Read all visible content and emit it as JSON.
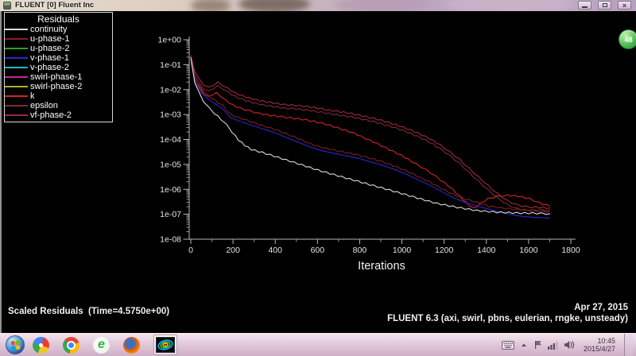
{
  "window": {
    "title": "FLUENT [0] Fluent Inc"
  },
  "legend": {
    "title": "Residuals",
    "items": [
      {
        "label": "continuity",
        "color": "#d9d9d9"
      },
      {
        "label": "u-phase-1",
        "color": "#8b2020"
      },
      {
        "label": "u-phase-2",
        "color": "#28a428"
      },
      {
        "label": "v-phase-1",
        "color": "#2828cc"
      },
      {
        "label": "v-phase-2",
        "color": "#20b8b8"
      },
      {
        "label": "swirl-phase-1",
        "color": "#c02898"
      },
      {
        "label": "swirl-phase-2",
        "color": "#b0b028"
      },
      {
        "label": "k",
        "color": "#d42424"
      },
      {
        "label": "epsilon",
        "color": "#7e2a38"
      },
      {
        "label": "vf-phase-2",
        "color": "#9e2a3e"
      }
    ]
  },
  "chart_data": {
    "type": "line",
    "title": "Scaled Residuals",
    "xlabel": "Iterations",
    "y_scale": "log",
    "ylim": [
      1e-08,
      1
    ],
    "xlim": [
      0,
      1820
    ],
    "grid": false,
    "legend_position": "top-left-box",
    "x_ticks": [
      0,
      200,
      400,
      600,
      800,
      1000,
      1200,
      1400,
      1600,
      1800
    ],
    "y_tick_labels": [
      "1e+00",
      "1e-01",
      "1e-02",
      "1e-03",
      "1e-04",
      "1e-05",
      "1e-06",
      "1e-07",
      "1e-08"
    ],
    "series": [
      {
        "name": "vf-phase-2",
        "color": "#9e2a3e",
        "jagged": true,
        "points": [
          [
            0,
            0.22
          ],
          [
            19,
            0.055
          ],
          [
            38,
            0.027
          ],
          [
            60,
            0.016
          ],
          [
            83,
            0.012
          ],
          [
            105,
            0.015
          ],
          [
            128,
            0.019
          ],
          [
            151,
            0.015
          ],
          [
            177,
            0.011
          ],
          [
            207,
            0.0075
          ],
          [
            245,
            0.0056
          ],
          [
            294,
            0.0042
          ],
          [
            343,
            0.0034
          ],
          [
            392,
            0.0029
          ],
          [
            444,
            0.0025
          ],
          [
            497,
            0.0023
          ],
          [
            550,
            0.0021
          ],
          [
            602,
            0.0018
          ],
          [
            655,
            0.0015
          ],
          [
            708,
            0.0013
          ],
          [
            761,
            0.0011
          ],
          [
            813,
            0.00088
          ],
          [
            866,
            0.0007
          ],
          [
            919,
            0.00053
          ],
          [
            971,
            0.00039
          ],
          [
            1024,
            0.00027
          ],
          [
            1077,
            0.00018
          ],
          [
            1130,
            0.00011
          ],
          [
            1182,
            6e-05
          ],
          [
            1228,
            3.1e-05
          ],
          [
            1273,
            1.6e-05
          ],
          [
            1318,
            6.9e-06
          ],
          [
            1363,
            3.1e-06
          ],
          [
            1408,
            1.4e-06
          ],
          [
            1454,
            6.6e-07
          ],
          [
            1499,
            3.5e-07
          ],
          [
            1544,
            2.4e-07
          ],
          [
            1589,
            2e-07
          ],
          [
            1634,
            1.9e-07
          ],
          [
            1702,
            1.8e-07
          ]
        ]
      },
      {
        "name": "epsilon",
        "color": "#7e2a38",
        "jagged": true,
        "points": [
          [
            0,
            0.2
          ],
          [
            19,
            0.04
          ],
          [
            38,
            0.019
          ],
          [
            60,
            0.011
          ],
          [
            83,
            0.0085
          ],
          [
            105,
            0.011
          ],
          [
            128,
            0.014
          ],
          [
            151,
            0.011
          ],
          [
            177,
            0.0079
          ],
          [
            207,
            0.0054
          ],
          [
            245,
            0.004
          ],
          [
            294,
            0.003
          ],
          [
            343,
            0.0024
          ],
          [
            392,
            0.0021
          ],
          [
            444,
            0.0018
          ],
          [
            497,
            0.0017
          ],
          [
            550,
            0.0015
          ],
          [
            602,
            0.0013
          ],
          [
            655,
            0.0011
          ],
          [
            708,
            0.00093
          ],
          [
            761,
            0.00081
          ],
          [
            813,
            0.00065
          ],
          [
            866,
            0.00052
          ],
          [
            919,
            0.00039
          ],
          [
            971,
            0.00029
          ],
          [
            1024,
            0.0002
          ],
          [
            1077,
            0.00013
          ],
          [
            1130,
            7.8e-05
          ],
          [
            1182,
            4.3e-05
          ],
          [
            1228,
            2.2e-05
          ],
          [
            1273,
            1.1e-05
          ],
          [
            1318,
            4.7e-06
          ],
          [
            1363,
            2.1e-06
          ],
          [
            1408,
            9.5e-07
          ],
          [
            1454,
            4.5e-07
          ],
          [
            1499,
            2.4e-07
          ],
          [
            1544,
            1.7e-07
          ],
          [
            1589,
            1.4e-07
          ],
          [
            1634,
            1.3e-07
          ],
          [
            1702,
            1.3e-07
          ]
        ]
      },
      {
        "name": "k",
        "color": "#d42424",
        "jagged": true,
        "points": [
          [
            0,
            0.19
          ],
          [
            19,
            0.03
          ],
          [
            38,
            0.013
          ],
          [
            60,
            0.0072
          ],
          [
            83,
            0.005
          ],
          [
            102,
            0.0063
          ],
          [
            121,
            0.0072
          ],
          [
            143,
            0.0054
          ],
          [
            169,
            0.0035
          ],
          [
            200,
            0.0024
          ],
          [
            233,
            0.0018
          ],
          [
            279,
            0.0014
          ],
          [
            324,
            0.0011
          ],
          [
            377,
            0.00093
          ],
          [
            433,
            0.00081
          ],
          [
            490,
            0.0007
          ],
          [
            546,
            0.00061
          ],
          [
            602,
            0.00049
          ],
          [
            659,
            0.00037
          ],
          [
            715,
            0.00026
          ],
          [
            772,
            0.00018
          ],
          [
            828,
            0.00011
          ],
          [
            885,
            6.7e-05
          ],
          [
            941,
            3.9e-05
          ],
          [
            998,
            2.3e-05
          ],
          [
            1047,
            1.3e-05
          ],
          [
            1092,
            7.9e-06
          ],
          [
            1137,
            4.6e-06
          ],
          [
            1182,
            2.4e-06
          ],
          [
            1220,
            1.4e-06
          ],
          [
            1258,
            7.1e-07
          ],
          [
            1288,
            3.9e-07
          ],
          [
            1318,
            2.3e-07
          ],
          [
            1341,
            1.7e-07
          ],
          [
            1371,
            2.7e-07
          ],
          [
            1408,
            4.2e-07
          ],
          [
            1454,
            5.3e-07
          ],
          [
            1499,
            5.7e-07
          ],
          [
            1551,
            5.3e-07
          ],
          [
            1604,
            4.2e-07
          ],
          [
            1649,
            2.9e-07
          ],
          [
            1702,
            2.1e-07
          ]
        ]
      },
      {
        "name": "u-phase-1",
        "color": "#7e1e1e",
        "jagged": true,
        "points": [
          [
            0,
            0.17
          ],
          [
            23,
            0.024
          ],
          [
            49,
            0.011
          ],
          [
            79,
            0.006
          ],
          [
            113,
            0.0038
          ],
          [
            151,
            0.0023
          ],
          [
            188,
            0.001
          ],
          [
            226,
            0.00076
          ],
          [
            282,
            0.00053
          ],
          [
            339,
            0.00036
          ],
          [
            395,
            0.00026
          ],
          [
            452,
            0.00017
          ],
          [
            508,
            0.00011
          ],
          [
            565,
            6.8e-05
          ],
          [
            621,
            4.8e-05
          ],
          [
            678,
            3.8e-05
          ],
          [
            734,
            3e-05
          ],
          [
            791,
            2.4e-05
          ],
          [
            847,
            1.8e-05
          ],
          [
            904,
            1.3e-05
          ],
          [
            960,
            8.8e-06
          ],
          [
            1017,
            5.7e-06
          ],
          [
            1073,
            3.4e-06
          ],
          [
            1130,
            2e-06
          ],
          [
            1186,
            1.1e-06
          ],
          [
            1243,
            6.2e-07
          ],
          [
            1299,
            4.1e-07
          ],
          [
            1356,
            3e-07
          ],
          [
            1412,
            2.1e-07
          ],
          [
            1469,
            1.8e-07
          ],
          [
            1525,
            1.6e-07
          ],
          [
            1582,
            1.5e-07
          ],
          [
            1638,
            1.5e-07
          ],
          [
            1702,
            1.5e-07
          ]
        ]
      },
      {
        "name": "v-phase-1",
        "color": "#2828cc",
        "jagged": false,
        "points": [
          [
            0,
            0.128
          ],
          [
            23,
            0.018
          ],
          [
            49,
            0.0079
          ],
          [
            79,
            0.0044
          ],
          [
            113,
            0.0028
          ],
          [
            151,
            0.0017
          ],
          [
            188,
            0.00076
          ],
          [
            226,
            0.00056
          ],
          [
            282,
            0.00039
          ],
          [
            339,
            0.00027
          ],
          [
            395,
            0.00019
          ],
          [
            452,
            0.00012
          ],
          [
            508,
            7.8e-05
          ],
          [
            565,
            5e-05
          ],
          [
            621,
            3.5e-05
          ],
          [
            678,
            2.8e-05
          ],
          [
            734,
            2.2e-05
          ],
          [
            791,
            1.8e-05
          ],
          [
            847,
            1.3e-05
          ],
          [
            904,
            9.3e-06
          ],
          [
            960,
            6.5e-06
          ],
          [
            1017,
            4.2e-06
          ],
          [
            1073,
            2.5e-06
          ],
          [
            1130,
            1.5e-06
          ],
          [
            1186,
            8.3e-07
          ],
          [
            1243,
            4.6e-07
          ],
          [
            1299,
            3e-07
          ],
          [
            1356,
            2.1e-07
          ],
          [
            1412,
            1.6e-07
          ],
          [
            1469,
            1.2e-07
          ],
          [
            1525,
            9.3e-08
          ],
          [
            1582,
            8e-08
          ],
          [
            1638,
            7.4e-08
          ],
          [
            1702,
            7e-08
          ]
        ]
      },
      {
        "name": "continuity",
        "color": "#d9d9d9",
        "jagged": true,
        "points": [
          [
            0,
            0.185
          ],
          [
            19,
            0.02
          ],
          [
            38,
            0.0079
          ],
          [
            60,
            0.0035
          ],
          [
            87,
            0.0018
          ],
          [
            113,
            0.0011
          ],
          [
            143,
            0.00065
          ],
          [
            169,
            0.00039
          ],
          [
            196,
            0.0002
          ],
          [
            226,
            9.6e-05
          ],
          [
            256,
            5.8e-05
          ],
          [
            286,
            4e-05
          ],
          [
            339,
            3e-05
          ],
          [
            414,
            1.9e-05
          ],
          [
            508,
            1.07e-05
          ],
          [
            602,
            5.9e-06
          ],
          [
            697,
            3.5e-06
          ],
          [
            791,
            2.1e-06
          ],
          [
            885,
            1.27e-06
          ],
          [
            979,
            7.6e-07
          ],
          [
            1073,
            4.5e-07
          ],
          [
            1167,
            2.7e-07
          ],
          [
            1261,
            1.9e-07
          ],
          [
            1356,
            1.4e-07
          ],
          [
            1450,
            1.21e-07
          ],
          [
            1544,
            1.13e-07
          ],
          [
            1619,
            1.1e-07
          ],
          [
            1702,
            1.05e-07
          ]
        ]
      }
    ]
  },
  "captions": {
    "left": "Scaled Residuals  (Time=4.5750e+00)",
    "date": "Apr 27, 2015",
    "solver": "FLUENT 6.3 (axi, swirl, pbns, eulerian, rngke, unsteady)"
  },
  "overlay": {
    "badge_value": "48"
  },
  "taskbar": {
    "clock_time": "10:45",
    "clock_date": "2015/4/27"
  }
}
